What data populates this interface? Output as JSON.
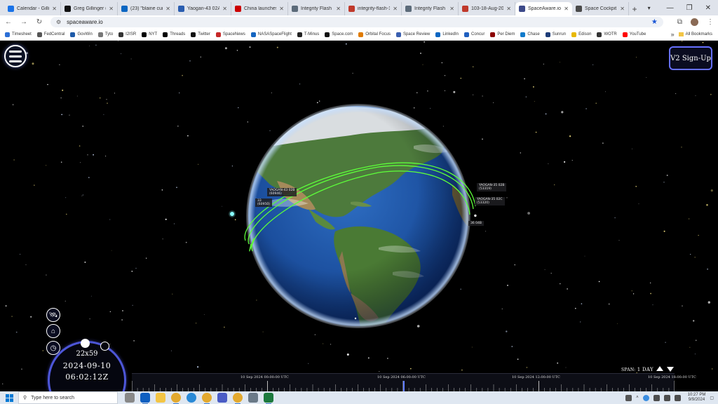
{
  "browser": {
    "tabs": [
      {
        "label": "Calendar - Gillinger",
        "color": "#1a73e8",
        "active": false
      },
      {
        "label": "Greg Gillinger (@",
        "color": "#111111",
        "active": false
      },
      {
        "label": "(23) \"blaine curci",
        "color": "#0a66c2",
        "active": false
      },
      {
        "label": "Yaogan-43 02A -",
        "color": "#2a5db0",
        "active": false
      },
      {
        "label": "China launches m",
        "color": "#cc0000",
        "active": false
      },
      {
        "label": "Integrity Flash -",
        "color": "#5c6b7a",
        "active": false
      },
      {
        "label": "integrity-flash-10",
        "color": "#c0392b",
        "active": false
      },
      {
        "label": "Integrity Flash -",
        "color": "#5c6b7a",
        "active": false
      },
      {
        "label": "103-18-Aug-2024",
        "color": "#c0392b",
        "active": false
      },
      {
        "label": "SpaceAware.io",
        "color": "#3d4a8a",
        "active": true
      },
      {
        "label": "Space Cockpit",
        "color": "#4a4a4a",
        "active": false
      }
    ],
    "url": "spaceaware.io",
    "bookmarks": [
      {
        "label": "Timesheet",
        "color": "#2b6fd6"
      },
      {
        "label": "FedCentral",
        "color": "#555555"
      },
      {
        "label": "GovWin",
        "color": "#1e5aa8"
      },
      {
        "label": "Tyto",
        "color": "#777777"
      },
      {
        "label": "I2ISR",
        "color": "#333333"
      },
      {
        "label": "NYT",
        "color": "#000000"
      },
      {
        "label": "Threads",
        "color": "#000000"
      },
      {
        "label": "Twitter",
        "color": "#111111"
      },
      {
        "label": "SpaceNews",
        "color": "#c62828"
      },
      {
        "label": "NASASpaceFlight",
        "color": "#1565c0"
      },
      {
        "label": "T-Minus",
        "color": "#222222"
      },
      {
        "label": "Space.com",
        "color": "#111111"
      },
      {
        "label": "Orbital Focus",
        "color": "#e07b00"
      },
      {
        "label": "Space Review",
        "color": "#3a5fb0"
      },
      {
        "label": "LinkedIn",
        "color": "#0a66c2"
      },
      {
        "label": "Concur",
        "color": "#1f5fbf"
      },
      {
        "label": "Per Diem",
        "color": "#8b0000"
      },
      {
        "label": "Chase",
        "color": "#117aca"
      },
      {
        "label": "Sunrun",
        "color": "#1d3c78"
      },
      {
        "label": "Edison",
        "color": "#e8b800"
      },
      {
        "label": "WOTR",
        "color": "#333333"
      },
      {
        "label": "YouTube",
        "color": "#ff0000"
      }
    ],
    "all_bookmarks": "All Bookmarks"
  },
  "app": {
    "signup_label": "V2 Sign-Up",
    "clock": {
      "value": "22x59",
      "date": "2024-09-10",
      "time": "06:02:12Z"
    },
    "span": {
      "label": "SPAN:",
      "value": "1 DAY"
    },
    "timeline_labels": [
      "10 Sep 2024 00:00:00 UTC",
      "10 Sep 2024 06:00:00 UTC",
      "10 Sep 2024 12:00:00 UTC",
      "10 Sep 2024 18:00:00 UTC"
    ],
    "timeline_cursor_fraction": 0.5,
    "satellites": [
      {
        "name": "YAOGAN-43 02B",
        "id": "(60946)"
      },
      {
        "name": "33",
        "id": "(60950)"
      },
      {
        "name": "YAOGAN-35 02B",
        "id": "(53319)"
      },
      {
        "name": "YAOGAN-35 02C",
        "id": "(53320)"
      },
      {
        "name": "36 04B",
        "id": ""
      }
    ],
    "colors": {
      "orbit": "#5dff3a",
      "accent": "#4d56d8",
      "signup_border": "#6670ff"
    }
  },
  "taskbar": {
    "search_placeholder": "Type here to search",
    "time": "10:27 PM",
    "date": "9/9/2024"
  }
}
